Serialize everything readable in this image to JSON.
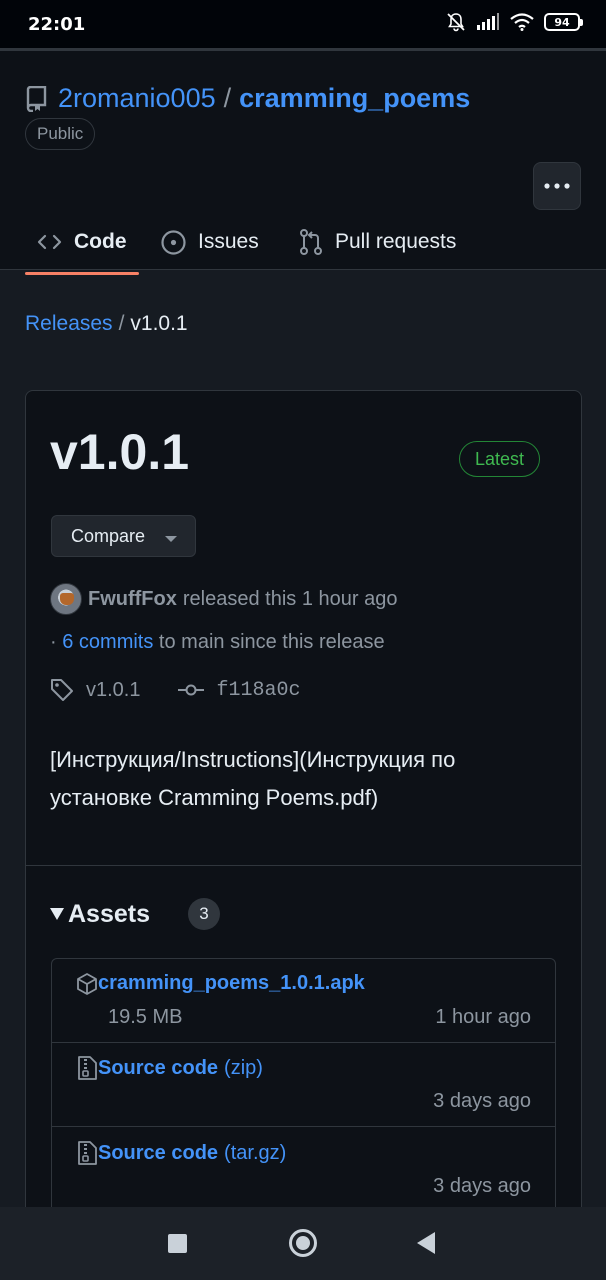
{
  "status_bar": {
    "time": "22:01",
    "battery": "94",
    "icons": [
      "bell-off-icon",
      "signal-icon",
      "wifi-icon",
      "battery-icon"
    ]
  },
  "repo": {
    "owner": "2romanio005",
    "separator": "/",
    "name": "cramming_poems",
    "visibility": "Public",
    "icon": "repo-icon"
  },
  "tabs": [
    {
      "label": "Code",
      "icon": "code-icon",
      "active": true
    },
    {
      "label": "Issues",
      "icon": "issue-opened-icon",
      "active": false
    },
    {
      "label": "Pull requests",
      "icon": "git-pull-request-icon",
      "active": false
    }
  ],
  "more_icon": "kebab-horizontal-icon",
  "breadcrumb": {
    "releases": "Releases",
    "separator": "/",
    "current": "v1.0.1"
  },
  "release": {
    "version": "v1.0.1",
    "badge": "Latest",
    "compare_label": "Compare",
    "author": "FwuffFox",
    "released_text": "released this 1 hour ago",
    "commits_prefix": "·",
    "commits_link": "6 commits",
    "commits_suffix": "to main since this release",
    "tag": "v1.0.1",
    "commit_sha": "f118a0c",
    "body": "[Инструкция/Instructions](Инструкция по установке Cramming Poems.pdf)"
  },
  "assets": {
    "title": "Assets",
    "count": "3",
    "items": [
      {
        "name": "cramming_poems_1.0.1.apk",
        "suffix": "",
        "size": "19.5 MB",
        "date": "1 hour ago",
        "icon": "package-icon"
      },
      {
        "name": "Source code",
        "suffix": "(zip)",
        "size": "",
        "date": "3 days ago",
        "icon": "file-zip-icon"
      },
      {
        "name": "Source code",
        "suffix": "(tar.gz)",
        "size": "",
        "date": "3 days ago",
        "icon": "file-zip-icon"
      }
    ]
  },
  "colors": {
    "background": "#161b22",
    "link": "#4493f8",
    "muted": "#8d96a0",
    "latest_green": "#3fb950",
    "active_tab_underline": "#f78166"
  }
}
